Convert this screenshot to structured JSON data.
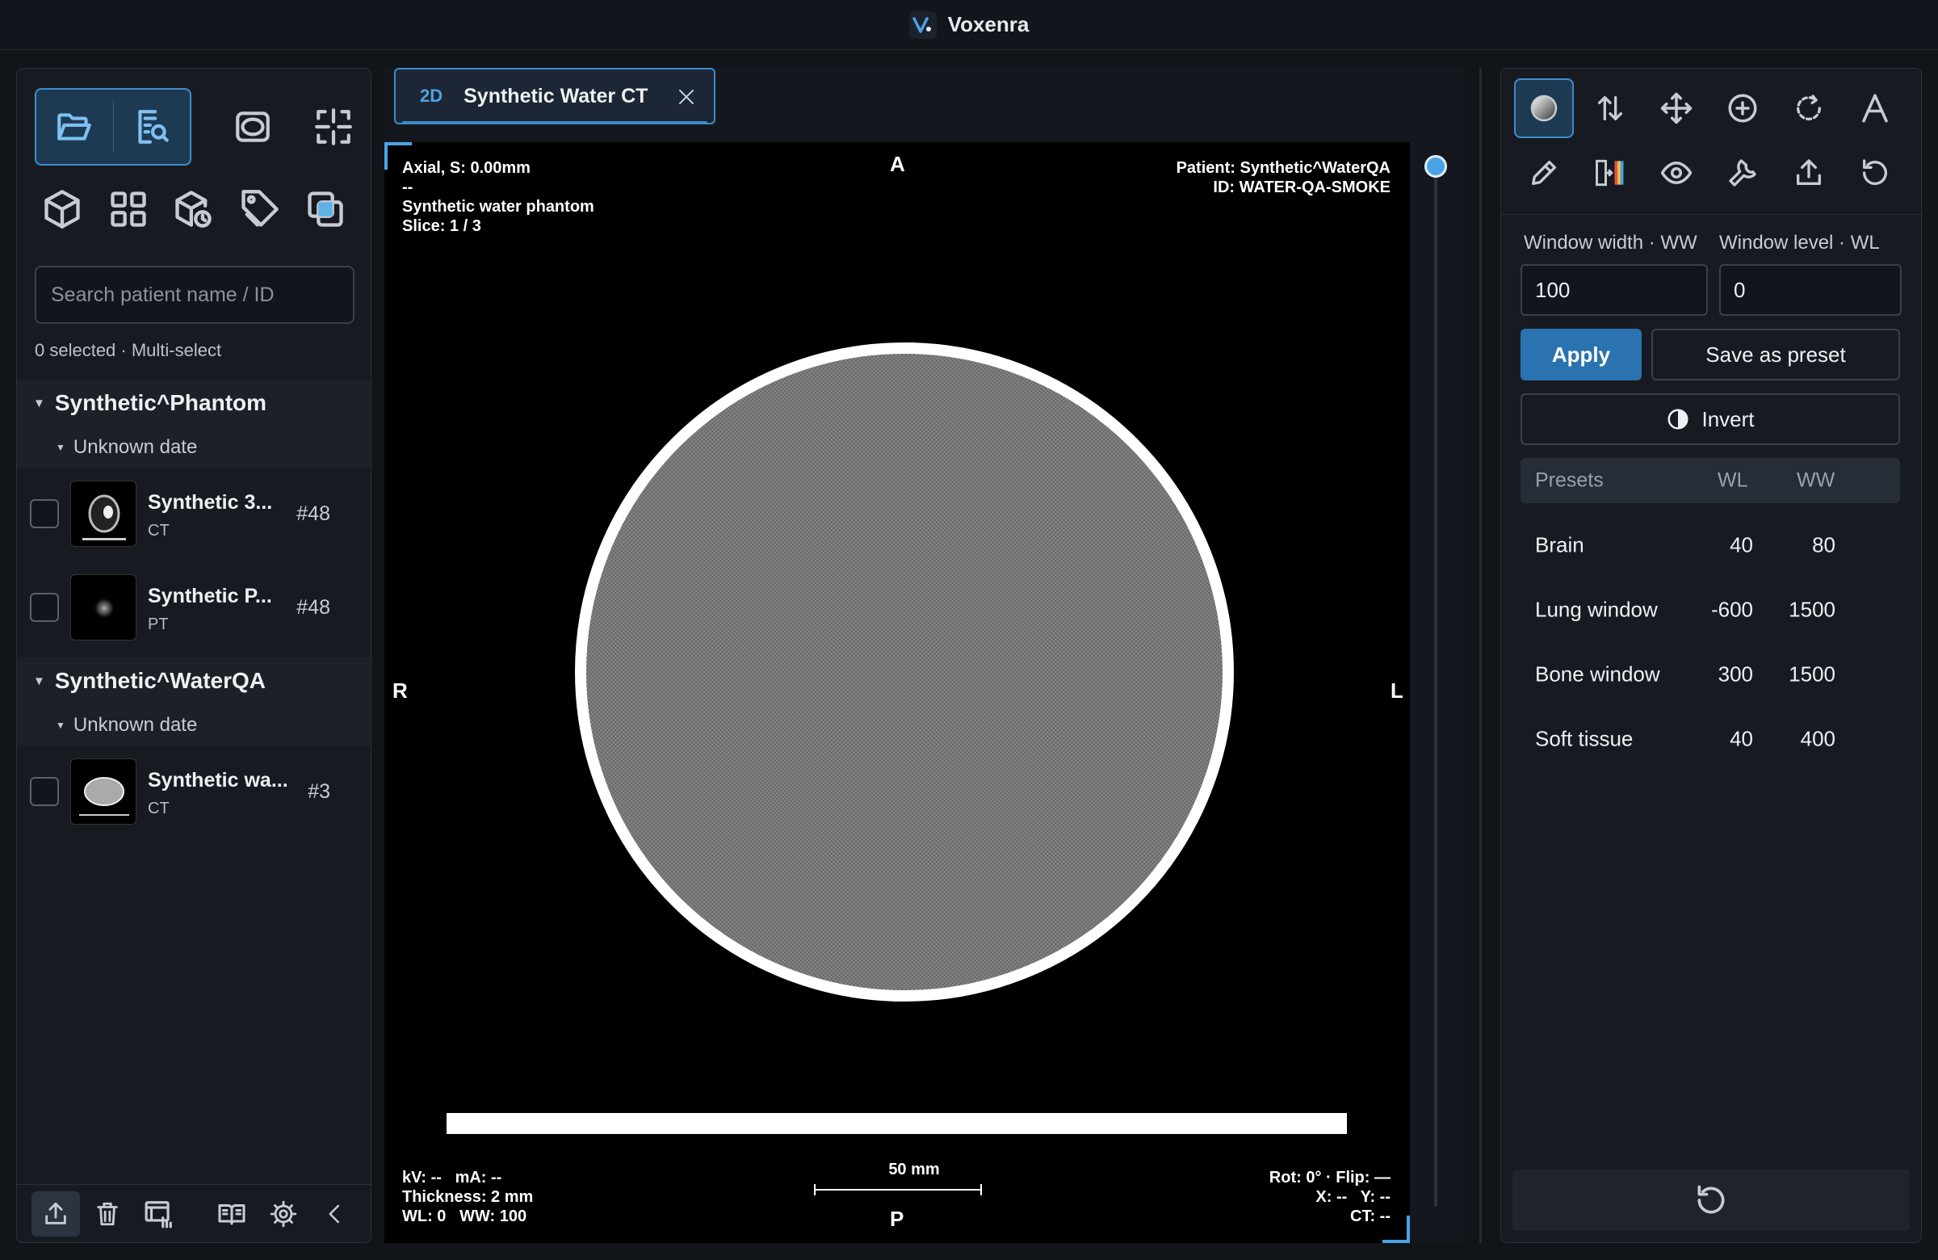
{
  "app": {
    "title": "Voxenra"
  },
  "sidebar": {
    "search_placeholder": "Search patient name / ID",
    "selection_info": "0 selected · Multi-select",
    "patients": [
      {
        "name": "Synthetic^Phantom",
        "date": "Unknown date",
        "series": [
          {
            "name": "Synthetic 3...",
            "modality": "CT",
            "count": "#48"
          },
          {
            "name": "Synthetic P...",
            "modality": "PT",
            "count": "#48"
          }
        ]
      },
      {
        "name": "Synthetic^WaterQA",
        "date": "Unknown date",
        "series": [
          {
            "name": "Synthetic wa...",
            "modality": "CT",
            "count": "#3"
          }
        ]
      }
    ]
  },
  "viewer": {
    "tab": {
      "mode": "2D",
      "title": "Synthetic Water CT"
    },
    "overlay": {
      "top_left": "Axial, S: 0.00mm\n--\nSynthetic water phantom\nSlice: 1 / 3",
      "top_right": "Patient: Synthetic^WaterQA\nID: WATER-QA-SMOKE",
      "bottom_left": "kV: --   mA: --\nThickness: 2 mm\nWL: 0   WW: 100",
      "bottom_right": "Rot: 0° · Flip: —\nX: --   Y: --\nCT: --",
      "scale": "50 mm",
      "orient_top": "A",
      "orient_bottom": "P",
      "orient_left": "R",
      "orient_right": "L"
    },
    "slice": {
      "current": 1,
      "total": 3
    }
  },
  "window_panel": {
    "ww_label": "Window width · WW",
    "wl_label": "Window level · WL",
    "ww_value": "100",
    "wl_value": "0",
    "apply_label": "Apply",
    "save_label": "Save as preset",
    "invert_label": "Invert",
    "presets_header": {
      "name": "Presets",
      "wl": "WL",
      "ww": "WW"
    },
    "presets": [
      {
        "name": "Brain",
        "wl": "40",
        "ww": "80"
      },
      {
        "name": "Lung window",
        "wl": "-600",
        "ww": "1500"
      },
      {
        "name": "Bone window",
        "wl": "300",
        "ww": "1500"
      },
      {
        "name": "Soft tissue",
        "wl": "40",
        "ww": "400"
      }
    ]
  },
  "colors": {
    "accent": "#3e8ccb",
    "background": "#111419",
    "panel": "#171b21",
    "primary_button": "#2a73b0"
  },
  "icons": {
    "sidebar_tabs": [
      "folder-open-icon",
      "series-search-icon",
      "ellipse-roi-icon",
      "crosshair-frame-icon"
    ],
    "sidebar_tools": [
      "cube-icon",
      "grid-layout-icon",
      "cube-history-icon",
      "tag-icon",
      "overlay-icon"
    ],
    "bottom": [
      "export-icon",
      "trash-icon",
      "layout-settings-icon",
      "book-icon",
      "gear-icon",
      "collapse-left-icon"
    ],
    "tools": [
      "window-level-icon",
      "scroll-icon",
      "pan-icon",
      "zoom-icon",
      "rotate-icon",
      "measure-icon",
      "pencil-icon",
      "colormap-icon",
      "eye-icon",
      "wrench-icon",
      "export-icon",
      "reset-icon"
    ]
  }
}
